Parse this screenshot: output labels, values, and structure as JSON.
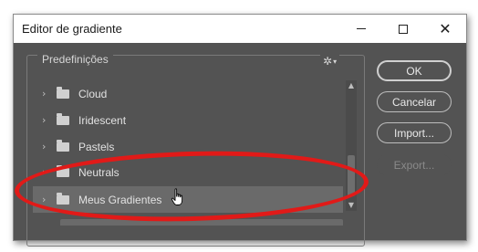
{
  "window": {
    "title": "Editor de gradiente"
  },
  "presets": {
    "legend": "Predefinições",
    "gear_icon": "gear-icon",
    "items": [
      {
        "label": "Cloud"
      },
      {
        "label": "Iridescent"
      },
      {
        "label": "Pastels"
      },
      {
        "label": "Neutrals"
      },
      {
        "label": "Meus Gradientes",
        "selected": true
      }
    ]
  },
  "buttons": {
    "ok": "OK",
    "cancel": "Cancelar",
    "import": "Import...",
    "export": "Export..."
  },
  "colors": {
    "dialog_bg": "#535353",
    "highlight_ellipse": "#e11a18",
    "selected_row": "#6a6a6a"
  }
}
